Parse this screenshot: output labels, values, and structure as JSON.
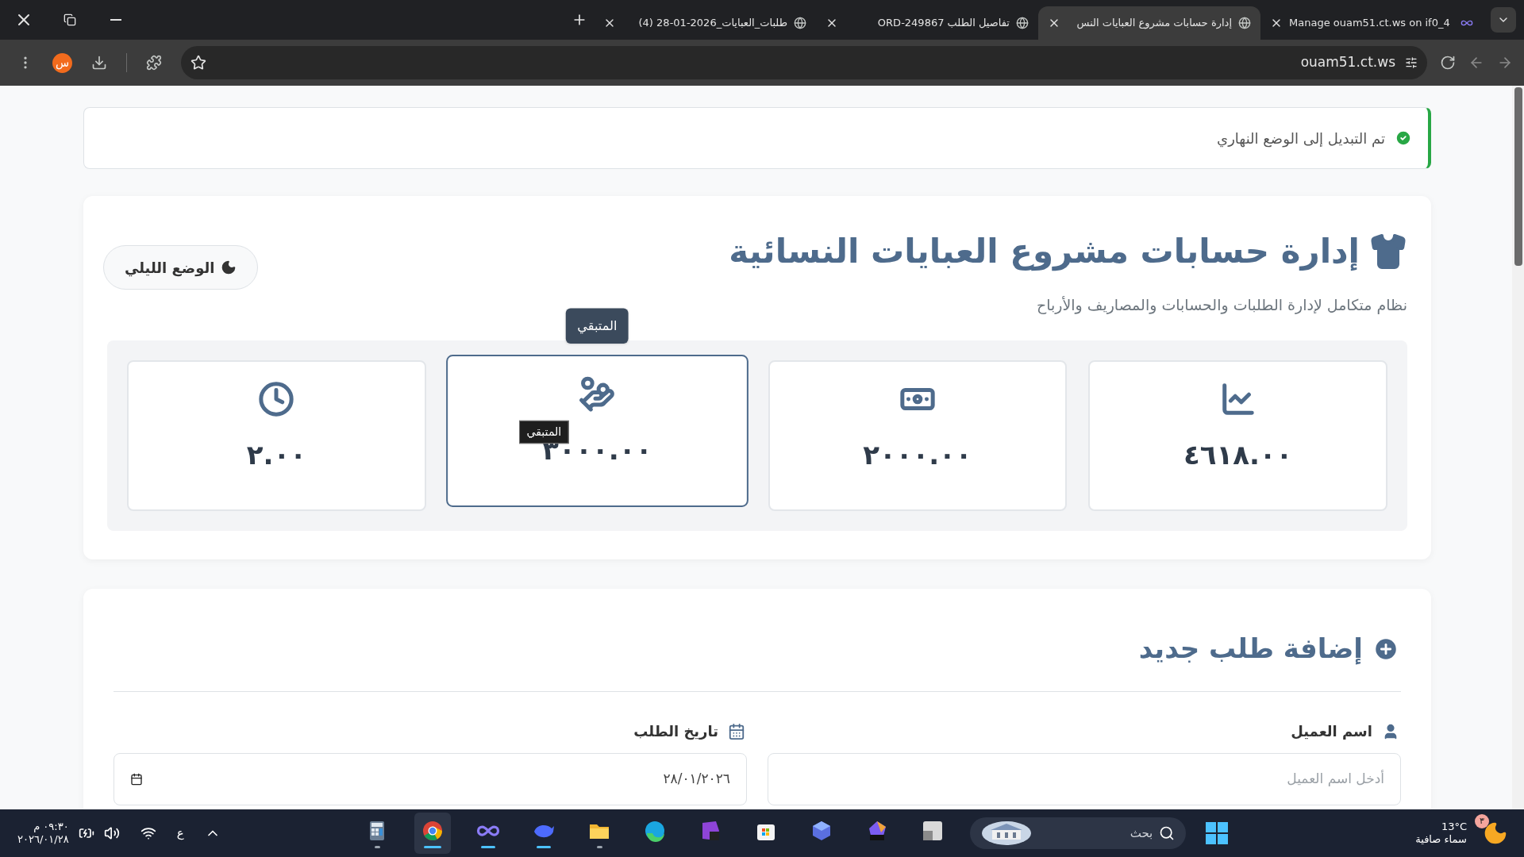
{
  "browser": {
    "tabs": [
      {
        "title": "Manage ouam51.ct.ws on if0_4",
        "kind": "infinity",
        "selected": false
      },
      {
        "title": "إدارة حسابات مشروع العبايات النس",
        "kind": "globe",
        "selected": true
      },
      {
        "title": "تفاصيل الطلب ORD-249867",
        "kind": "globe",
        "selected": false
      },
      {
        "title": "طلبات_العبايات_2026-01-28 (4)",
        "kind": "globe",
        "selected": false
      }
    ],
    "profile_initial": "س",
    "url": "ouam51.ct.ws"
  },
  "toast": {
    "message": "تم التبديل إلى الوضع النهاري"
  },
  "header": {
    "title": "إدارة حسابات مشروع العبايات النسائية",
    "subtitle": "نظام متكامل لإدارة الطلبات والحسابات والمصاريف والأرباح",
    "theme_button": "الوضع الليلي"
  },
  "stats": [
    {
      "kind": "chart",
      "value": "٤٦١٨.٠٠",
      "hovered": false
    },
    {
      "kind": "money",
      "value": "٢٠٠٠.٠٠",
      "hovered": false
    },
    {
      "kind": "hand",
      "value": "٣٠٠٠.٠٠",
      "hovered": true,
      "tooltip": "المتبقي",
      "native_tooltip": "المتبقي"
    },
    {
      "kind": "clock",
      "value": "٢.٠٠",
      "hovered": false
    }
  ],
  "form": {
    "title": "إضافة طلب جديد",
    "fields": [
      {
        "kind": "user",
        "label": "اسم العميل",
        "placeholder": "أدخل اسم العميل"
      },
      {
        "kind": "calendar",
        "label": "تاريخ الطلب",
        "value": "٢٨/٠١/٢٠٢٦"
      }
    ]
  },
  "taskbar": {
    "weather": {
      "badge": "٣",
      "temperature": "13°C",
      "condition": "سماء صافية"
    },
    "search_placeholder": "بحث",
    "apps": [
      {
        "kind": "square",
        "open": false,
        "active": false,
        "selected": false
      },
      {
        "kind": "m365",
        "open": false,
        "active": false,
        "selected": false
      },
      {
        "kind": "cube",
        "open": false,
        "active": false,
        "selected": false
      },
      {
        "kind": "store",
        "open": false,
        "active": false,
        "selected": false
      },
      {
        "kind": "studio",
        "open": false,
        "active": false,
        "selected": false
      },
      {
        "kind": "edge",
        "open": false,
        "active": false,
        "selected": false
      },
      {
        "kind": "files",
        "open": true,
        "active": false,
        "selected": false
      },
      {
        "kind": "whale",
        "open": true,
        "active": true,
        "selected": false
      },
      {
        "kind": "infinity",
        "open": true,
        "active": true,
        "selected": false
      },
      {
        "kind": "chrome",
        "open": true,
        "active": true,
        "selected": true
      },
      {
        "kind": "calculator",
        "open": true,
        "active": false,
        "selected": false
      }
    ],
    "language": "ع",
    "time": "٠٩:٣٠ م",
    "date": "٢٠٢٦/٠١/٢٨"
  }
}
